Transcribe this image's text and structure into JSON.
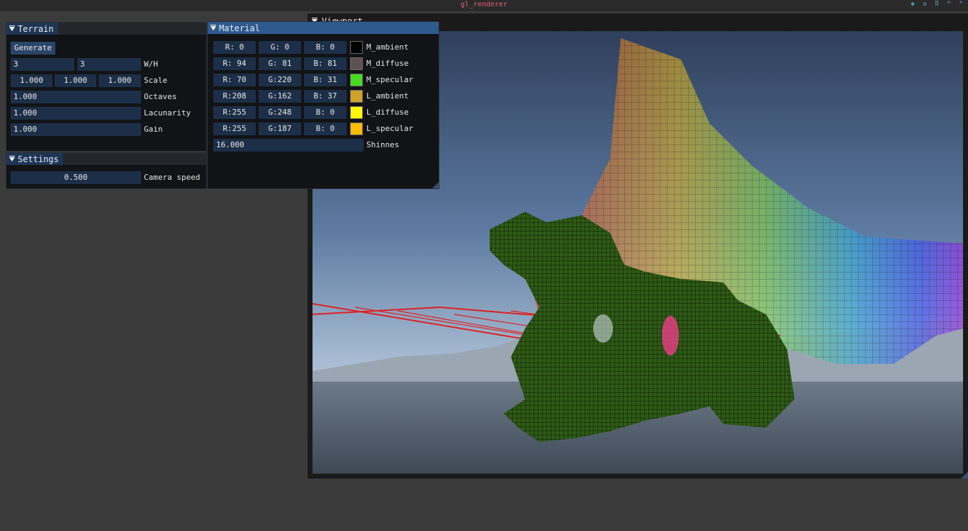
{
  "app": {
    "title": "gl_renderer"
  },
  "wm_icons": [
    "pin-icon",
    "float-icon",
    "grid-icon",
    "maximize-icon",
    "close-icon"
  ],
  "wm_glyphs": [
    "✥",
    "⠶",
    "⠿",
    "⌃",
    "⌃"
  ],
  "terrain": {
    "title": "Terrain",
    "generate_label": "Generate",
    "width_value": "3",
    "height_value": "3",
    "wh_label": "W/H",
    "scale_values": [
      "1.000",
      "1.000",
      "1.000"
    ],
    "scale_label": "Scale",
    "octaves_value": "1.000",
    "octaves_label": "Octaves",
    "lacunarity_value": "1.000",
    "lacunarity_label": "Lacunarity",
    "gain_value": "1.000",
    "gain_label": "Gain"
  },
  "settings": {
    "title": "Settings",
    "camera_speed_value": "0.500",
    "camera_speed_label": "Camera speed"
  },
  "material": {
    "title": "Material",
    "rows": [
      {
        "r": "R:  0",
        "g": "G:  0",
        "b": "B:  0",
        "color": "#000000",
        "label": "M_ambient"
      },
      {
        "r": "R: 94",
        "g": "G: 81",
        "b": "B: 81",
        "color": "#5e5151",
        "label": "M_diffuse"
      },
      {
        "r": "R: 70",
        "g": "G:220",
        "b": "B: 31",
        "color": "#46dc1f",
        "label": "M_specular"
      },
      {
        "r": "R:208",
        "g": "G:162",
        "b": "B: 37",
        "color": "#d0a225",
        "label": "L_ambient"
      },
      {
        "r": "R:255",
        "g": "G:248",
        "b": "B:  0",
        "color": "#fff800",
        "label": "L_diffuse"
      },
      {
        "r": "R:255",
        "g": "G:187",
        "b": "B:  0",
        "color": "#ffbb00",
        "label": "L_specular"
      }
    ],
    "shininess_value": "16.000",
    "shininess_label": "Shinnes"
  },
  "viewport": {
    "title": "Viewport"
  },
  "colors": {
    "accent_tab": "#2e5a8e",
    "frame_bg": "#1d2f48",
    "window_bg": "#121316",
    "title_text": "#e0607a"
  }
}
